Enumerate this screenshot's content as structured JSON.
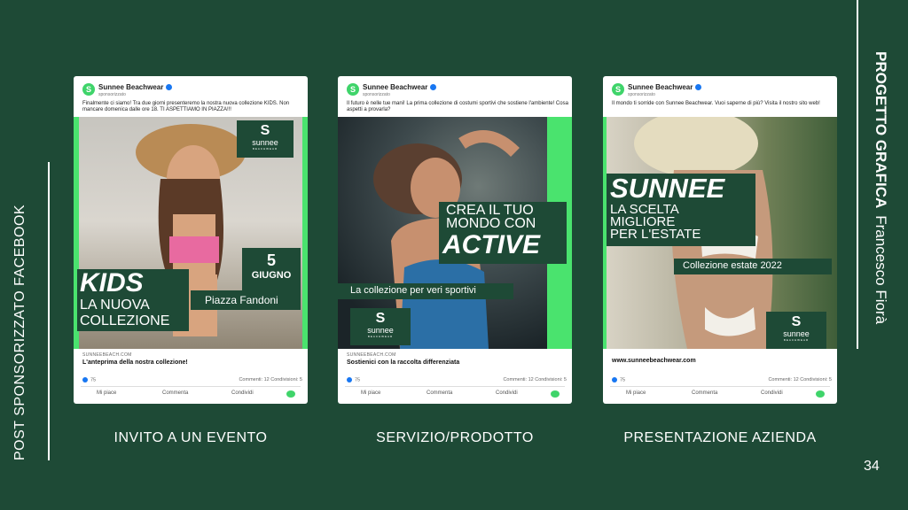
{
  "left_title": "POST SPONSORIZZATO FACEBOOK",
  "right_title": {
    "bold": "PROGETTO GRAFICA",
    "author": "Francesco Fiorà"
  },
  "page_number": "34",
  "colors": {
    "background": "#1e4a36",
    "accent_green": "#4ae36e",
    "fb_blue": "#1877f2"
  },
  "posts": [
    {
      "page_name": "Sunnee Beachwear",
      "sponsored": "sponsorizzato",
      "caption": "Finalmente ci siamo! Tra due giorni presenteremo la nostra nuova collezione KIDS. Non mancare domenica dalle ore 18. TI ASPETTIAMO IN PIAZZA!!!",
      "brand": {
        "mark": "S",
        "word": "sunnee",
        "sub": "BEACHWEAR"
      },
      "overlay": {
        "big": "KIDS",
        "line1": "LA NUOVA",
        "line2": "COLLEZIONE",
        "date_num": "5",
        "date_month": "GIUGNO",
        "place": "Piazza Fandoni"
      },
      "link": "SUNNEEBEACH.COM",
      "headline": "L'anteprima della nostra collezione!",
      "likes": "75",
      "comments_shares": "Commenti: 12  Condivisioni: 5",
      "actions": [
        "Mi piace",
        "Commenta",
        "Condividi"
      ],
      "label": "INVITO A UN EVENTO"
    },
    {
      "page_name": "Sunnee Beachwear",
      "sponsored": "sponsorizzato",
      "caption": "Il futuro è nelle tue mani! La prima collezione di costumi sportivi che sostiene l'ambiente! Cosa aspetti a provarla?",
      "brand": {
        "mark": "S",
        "word": "sunnee",
        "sub": "BEACHWEAR"
      },
      "overlay": {
        "line1": "CREA IL TUO",
        "line2": "MONDO CON",
        "big": "ACTIVE",
        "sub": "La collezione per veri sportivi"
      },
      "link": "SUNNEEBEACH.COM",
      "headline": "Sostienici con la raccolta differenziata",
      "likes": "75",
      "comments_shares": "Commenti: 12  Condivisioni: 5",
      "actions": [
        "Mi piace",
        "Commenta",
        "Condividi"
      ],
      "label": "SERVIZIO/PRODOTTO"
    },
    {
      "page_name": "Sunnee Beachwear",
      "sponsored": "sponsorizzato",
      "caption": "Il mondo ti sorride con Sunnee Beachwear. Vuoi saperne di più? Visita il nostro sito web!",
      "brand": {
        "mark": "S",
        "word": "sunnee",
        "sub": "BEACHWEAR"
      },
      "overlay": {
        "big": "SUNNEE",
        "line1": "LA SCELTA",
        "line2": "MIGLIORE",
        "line3": "PER L'ESTATE",
        "sub": "Collezione estate 2022"
      },
      "link": "",
      "headline": "www.sunneebeachwear.com",
      "likes": "75",
      "comments_shares": "Commenti: 12  Condivisioni: 5",
      "actions": [
        "Mi piace",
        "Commenta",
        "Condividi"
      ],
      "label": "PRESENTAZIONE AZIENDA"
    }
  ]
}
